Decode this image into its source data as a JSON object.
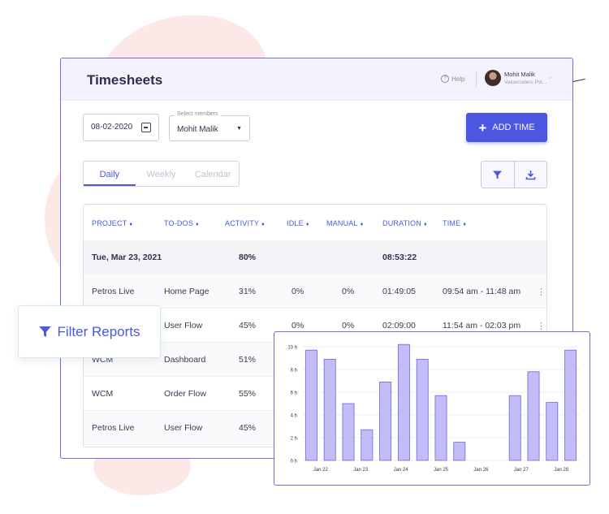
{
  "header": {
    "title": "Timesheets",
    "help_label": "Help",
    "user_name": "Mohit Malik",
    "user_org": "Valuecoders Pvt..."
  },
  "controls": {
    "date_value": "08-02-2020",
    "members_legend": "Select members",
    "members_value": "Mohit Malik",
    "add_time_label": "ADD TIME"
  },
  "tabs": [
    {
      "label": "Daily",
      "active": true
    },
    {
      "label": "Weekly"
    },
    {
      "label": "Calendar"
    }
  ],
  "icons": {
    "filter": "filter-icon",
    "download": "download-icon",
    "calendar": "calendar-icon",
    "avatar": "user-avatar"
  },
  "table": {
    "columns": [
      "PROJECT",
      "TO-DOS",
      "ACTIVITY",
      "IDLE",
      "MANUAL",
      "DURATION",
      "TIME"
    ],
    "date_row": {
      "date": "Tue, Mar 23, 2021",
      "activity": "80%",
      "duration": "08:53:22"
    },
    "rows": [
      {
        "project": "Petros Live",
        "todo": "Home Page",
        "activity": "31%",
        "idle": "0%",
        "manual": "0%",
        "duration": "01:49:05",
        "time": "09:54 am - 11:48 am"
      },
      {
        "project": "",
        "todo": "User Flow",
        "activity": "45%",
        "idle": "0%",
        "manual": "0%",
        "duration": "02:09:00",
        "time": "11:54 am - 02:03 pm"
      },
      {
        "project": "WCM",
        "todo": "Dashboard",
        "activity": "51%"
      },
      {
        "project": "WCM",
        "todo": "Order Flow",
        "activity": "55%"
      },
      {
        "project": "Petros Live",
        "todo": "User Flow",
        "activity": "45%"
      }
    ]
  },
  "filter_card": {
    "label": "Filter Reports"
  },
  "colors": {
    "accent": "#4b57e0",
    "bar": "#c2bdf6",
    "bar_stroke": "#6f66de"
  },
  "chart_data": {
    "type": "bar",
    "ylabel": "",
    "ylim": [
      0,
      10
    ],
    "yticks": [
      "0 h",
      "2 h",
      "4 h",
      "6 h",
      "8 h",
      "10 h"
    ],
    "x_labels": [
      "Jan 22",
      "Jan 23",
      "Jan 24",
      "Jan 25",
      "Jan 26",
      "Jan 27",
      "Jan 28"
    ],
    "values": [
      9.7,
      8.9,
      5.0,
      2.7,
      6.9,
      10.2,
      8.9,
      5.7,
      1.6,
      0,
      0,
      5.7,
      7.8,
      5.1,
      9.7
    ]
  }
}
